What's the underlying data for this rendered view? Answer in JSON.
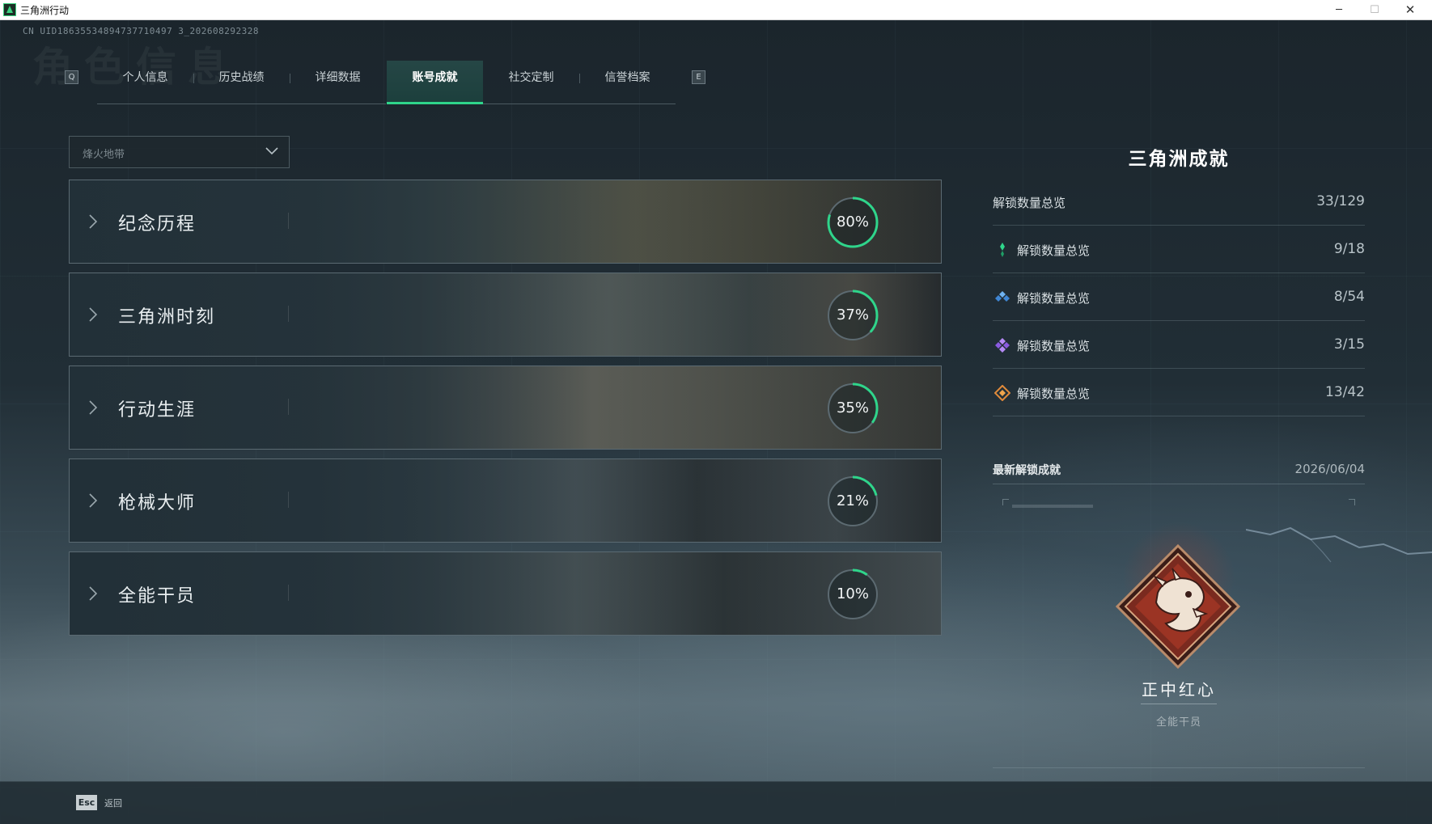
{
  "window": {
    "title": "三角洲行动",
    "minimize_glyph": "─",
    "maximize_glyph": "☐",
    "close_glyph": "✕"
  },
  "header": {
    "uid": "CN UID18635534894737710497 3_202608292328",
    "ghost_title": "角色信息"
  },
  "tabs": {
    "left_key": "Q",
    "right_key": "E",
    "items": [
      {
        "label": "个人信息",
        "active": false
      },
      {
        "label": "历史战绩",
        "active": false
      },
      {
        "label": "详细数据",
        "active": false
      },
      {
        "label": "账号成就",
        "active": true
      },
      {
        "label": "社交定制",
        "active": false
      },
      {
        "label": "信誉档案",
        "active": false
      }
    ]
  },
  "filter": {
    "selected": "烽火地带"
  },
  "categories": [
    {
      "label": "纪念历程",
      "percent_text": "80%",
      "percent": 0.8,
      "theme": "desk"
    },
    {
      "label": "三角洲时刻",
      "percent_text": "37%",
      "percent": 0.37,
      "theme": "operators"
    },
    {
      "label": "行动生涯",
      "percent_text": "35%",
      "percent": 0.35,
      "theme": "ruins"
    },
    {
      "label": "枪械大师",
      "percent_text": "21%",
      "percent": 0.21,
      "theme": "weapon"
    },
    {
      "label": "全能干员",
      "percent_text": "10%",
      "percent": 0.1,
      "theme": "soldier"
    }
  ],
  "summary": {
    "title": "三角洲成就",
    "total": {
      "label": "解锁数量总览",
      "value": "33/129"
    },
    "tiers": [
      {
        "label": "解锁数量总览",
        "value": "9/18",
        "icon": "green-diamond-icon",
        "color": "#2fd58b"
      },
      {
        "label": "解锁数量总览",
        "value": "8/54",
        "icon": "blue-diamond-icon",
        "color": "#4a97e0"
      },
      {
        "label": "解锁数量总览",
        "value": "3/15",
        "icon": "purple-diamond-icon",
        "color": "#9a6ae8"
      },
      {
        "label": "解锁数量总览",
        "value": "13/42",
        "icon": "gold-diamond-icon",
        "color": "#e08a3a"
      }
    ]
  },
  "latest": {
    "label": "最新解锁成就",
    "date": "2026/06/04",
    "badge_name": "正中红心",
    "badge_category": "全能干员",
    "badge_icon": "dragon-badge-icon"
  },
  "footer": {
    "esc_key": "Esc",
    "esc_label": "返回"
  },
  "colors": {
    "accent": "#2fd58b",
    "ring_track": "#5c6a71"
  }
}
